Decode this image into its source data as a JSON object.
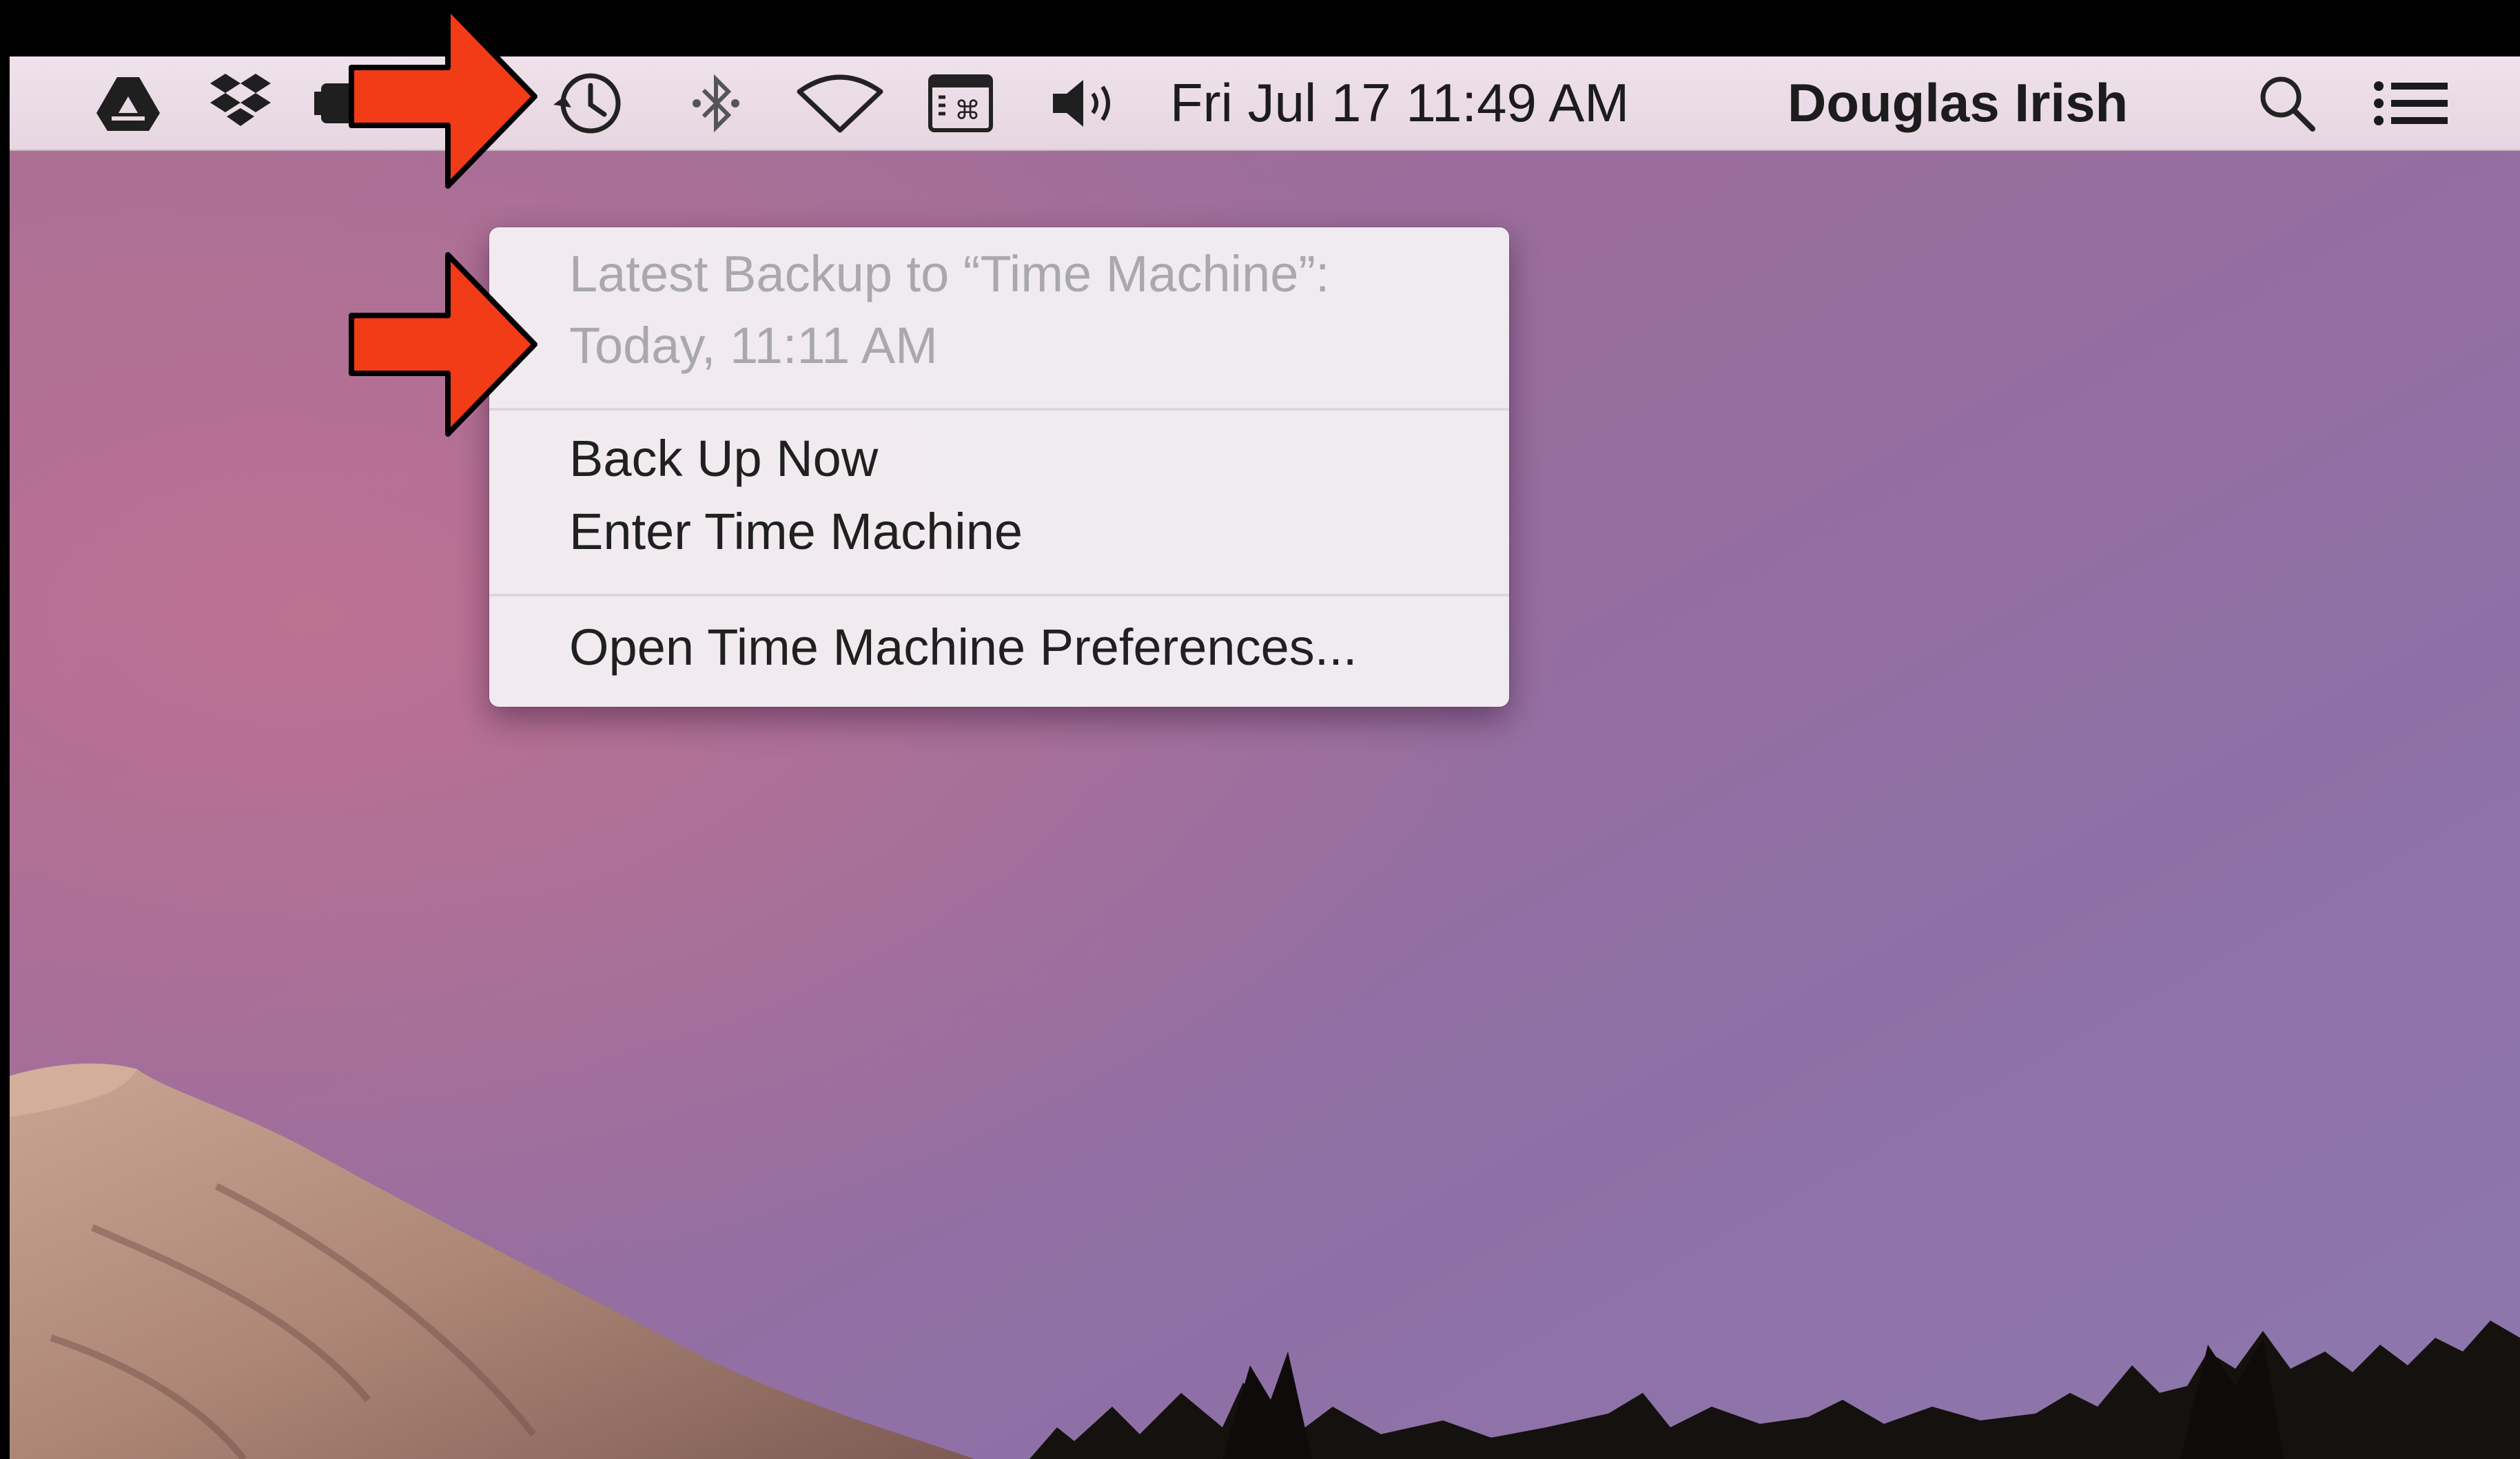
{
  "colors": {
    "annotation_arrow": "#f23b17",
    "menubar": "#ebdde6",
    "menu_background": "#f3f0f3",
    "disabled_text": "#a9a9ad"
  },
  "menubar": {
    "icons": [
      {
        "name": "google-drive-icon"
      },
      {
        "name": "dropbox-icon"
      },
      {
        "name": "battery-icon"
      },
      {
        "name": "time-machine-icon"
      },
      {
        "name": "bluetooth-icon"
      },
      {
        "name": "wifi-icon"
      },
      {
        "name": "keyboard-shortcut-icon"
      },
      {
        "name": "volume-icon"
      },
      {
        "name": "spotlight-search-icon"
      },
      {
        "name": "notification-center-icon"
      }
    ],
    "clock": "Fri Jul 17  11:49 AM",
    "user_name": "Douglas Irish"
  },
  "time_machine_menu": {
    "status_line1": "Latest Backup to “Time Machine”:",
    "status_line2": "Today, 11:11 AM",
    "back_up_now": "Back Up Now",
    "enter_time_machine": "Enter Time Machine",
    "open_preferences": "Open Time Machine Preferences..."
  }
}
